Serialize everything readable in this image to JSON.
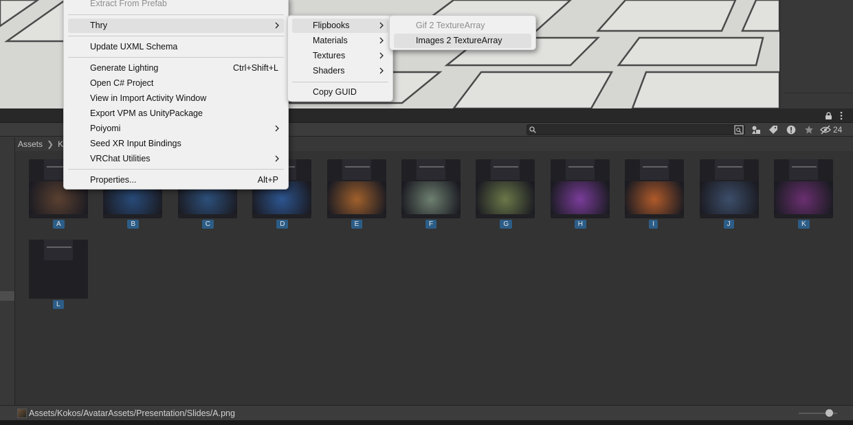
{
  "scene": {},
  "project": {
    "search": {
      "placeholder": "",
      "value": ""
    },
    "toolbar": {
      "hidden_count": "24"
    },
    "breadcrumb": [
      "Assets",
      "Ko"
    ],
    "assets": [
      {
        "label": "A",
        "thumb": "#5a4030"
      },
      {
        "label": "B",
        "thumb": "#274a78"
      },
      {
        "label": "C",
        "thumb": "#2c4f7a"
      },
      {
        "label": "D",
        "thumb": "#2c5590"
      },
      {
        "label": "E",
        "thumb": "#a0602c"
      },
      {
        "label": "F",
        "thumb": "#6e8070"
      },
      {
        "label": "G",
        "thumb": "#6a7848"
      },
      {
        "label": "H",
        "thumb": "#7a3c9a"
      },
      {
        "label": "I",
        "thumb": "#b05a2a"
      },
      {
        "label": "J",
        "thumb": "#3c4e6a"
      },
      {
        "label": "K",
        "thumb": "#6a2f70"
      },
      {
        "label": "L",
        "thumb": "#202024"
      }
    ],
    "status_path": "Assets/Kokos/AvatarAssets/Presentation/Slides/A.png"
  },
  "menus": {
    "main": {
      "items": [
        {
          "label": "Extract From Prefab",
          "disabled": true
        },
        {
          "label": "Thry",
          "submenu": true,
          "highlighted": true
        },
        {
          "label": "Update UXML Schema"
        },
        {
          "label": "Generate Lighting",
          "shortcut": "Ctrl+Shift+L"
        },
        {
          "label": "Open C# Project"
        },
        {
          "label": "View in Import Activity Window"
        },
        {
          "label": "Export VPM as UnityPackage"
        },
        {
          "label": "Poiyomi",
          "submenu": true
        },
        {
          "label": "Seed XR Input Bindings"
        },
        {
          "label": "VRChat Utilities",
          "submenu": true
        },
        {
          "label": "Properties...",
          "shortcut": "Alt+P"
        }
      ]
    },
    "thry": {
      "items": [
        {
          "label": "Flipbooks",
          "submenu": true,
          "highlighted": true
        },
        {
          "label": "Materials",
          "submenu": true
        },
        {
          "label": "Textures",
          "submenu": true
        },
        {
          "label": "Shaders",
          "submenu": true
        },
        {
          "label": "Copy GUID"
        }
      ]
    },
    "flipbooks": {
      "items": [
        {
          "label": "Gif 2 TextureArray",
          "disabled": true
        },
        {
          "label": "Images 2 TextureArray",
          "highlighted": true
        }
      ]
    }
  }
}
